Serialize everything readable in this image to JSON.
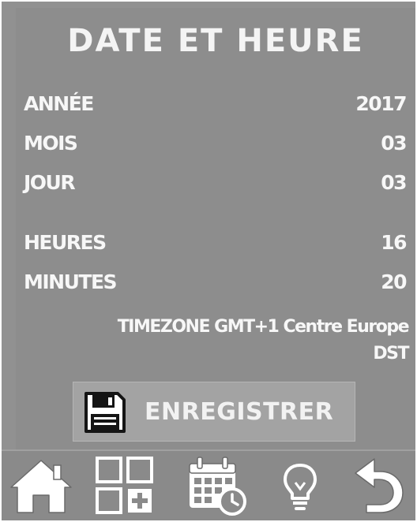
{
  "title": "DATE ET HEURE",
  "fields": {
    "year": {
      "label": "ANNÉE",
      "value": "2017"
    },
    "month": {
      "label": "MOIS",
      "value": "03"
    },
    "day": {
      "label": "JOUR",
      "value": "03"
    },
    "hours": {
      "label": "HEURES",
      "value": "16"
    },
    "minutes": {
      "label": "MINUTES",
      "value": "20"
    }
  },
  "timezone": {
    "line1": "TIMEZONE GMT+1 Centre Europe",
    "line2": "DST"
  },
  "save_button": {
    "label": "ENREGISTRER",
    "icon": "floppy-disk-icon"
  },
  "nav": {
    "home_icon": "home-icon",
    "grid_icon": "grid-add-icon",
    "calendar_icon": "calendar-clock-icon",
    "bulb_icon": "light-bulb-icon",
    "back_icon": "back-arrow-icon"
  },
  "colors": {
    "background": "#8d8d8d",
    "text": "#f4f4f4",
    "button": "#a3a3a3",
    "accent_blue": "#2f5fb0"
  }
}
